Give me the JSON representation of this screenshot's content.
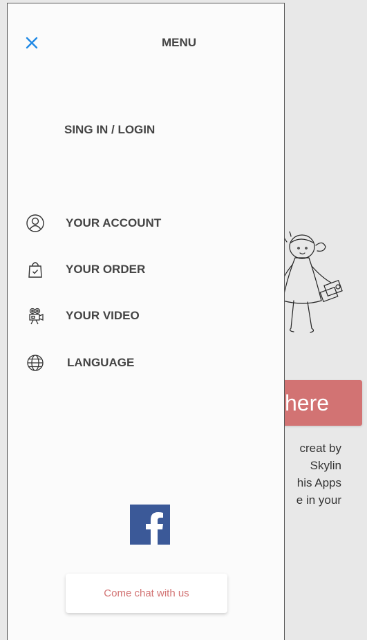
{
  "background": {
    "cta_label": "here",
    "text_lines": [
      "creat by",
      "Skylin",
      "his Apps",
      "e in your"
    ],
    "cta_color": "#d27373"
  },
  "drawer": {
    "title": "MENU",
    "close_icon": "close-icon",
    "accent_color": "#1e88e5",
    "signin_label": "SING IN / LOGIN",
    "items": [
      {
        "icon": "account-icon",
        "label": "YOUR ACCOUNT"
      },
      {
        "icon": "shopping-bag-icon",
        "label": "YOUR ORDER"
      },
      {
        "icon": "video-camera-icon",
        "label": "YOUR VIDEO"
      },
      {
        "icon": "globe-icon",
        "label": "LANGUAGE"
      }
    ],
    "social_icon": "facebook-icon",
    "social_color": "#3b5998",
    "chat_label": "Come chat with us"
  }
}
